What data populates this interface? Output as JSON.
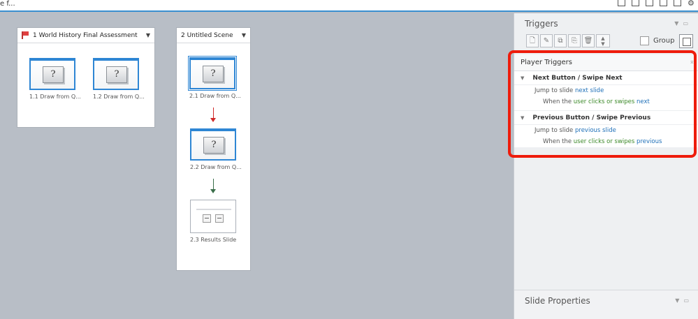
{
  "app": {
    "title_fragment": "e f..."
  },
  "scenes": [
    {
      "name": "1 World History Final Assessment",
      "slides": [
        {
          "label": "1.1 Draw from Q...",
          "glyph": "?"
        },
        {
          "label": "1.2 Draw from Q...",
          "glyph": "?"
        }
      ]
    },
    {
      "name": "2 Untitled Scene",
      "slides": [
        {
          "label": "2.1 Draw from Q...",
          "glyph": "?"
        },
        {
          "label": "2.2 Draw from Q...",
          "glyph": "?"
        },
        {
          "label": "2.3 Results Slide"
        }
      ]
    }
  ],
  "triggers_panel": {
    "title": "Triggers",
    "group_label": "Group",
    "section_title": "Player Triggers",
    "groups": [
      {
        "title": "Next Button / Swipe Next",
        "action_text": "Jump to slide",
        "action_target": "next slide",
        "when_text": "When the",
        "when_who": "user",
        "when_action": "clicks or swipes",
        "when_object": "next"
      },
      {
        "title": "Previous Button / Swipe Previous",
        "action_text": "Jump to slide",
        "action_target": "previous slide",
        "when_text": "When the",
        "when_who": "user",
        "when_action": "clicks or swipes",
        "when_object": "previous"
      }
    ]
  },
  "properties_panel": {
    "title": "Slide Properties"
  },
  "colors": {
    "accent": "#2e86d4",
    "highlight": "#ee1c0c",
    "link": "#1e6fb8",
    "green_text": "#3d8a2a"
  },
  "icons": [
    "flag-icon",
    "question-mark-icon",
    "gear-icon",
    "new-trigger-icon",
    "edit-trigger-icon",
    "copy-icon",
    "paste-icon",
    "delete-icon",
    "move-up-down-icon"
  ]
}
